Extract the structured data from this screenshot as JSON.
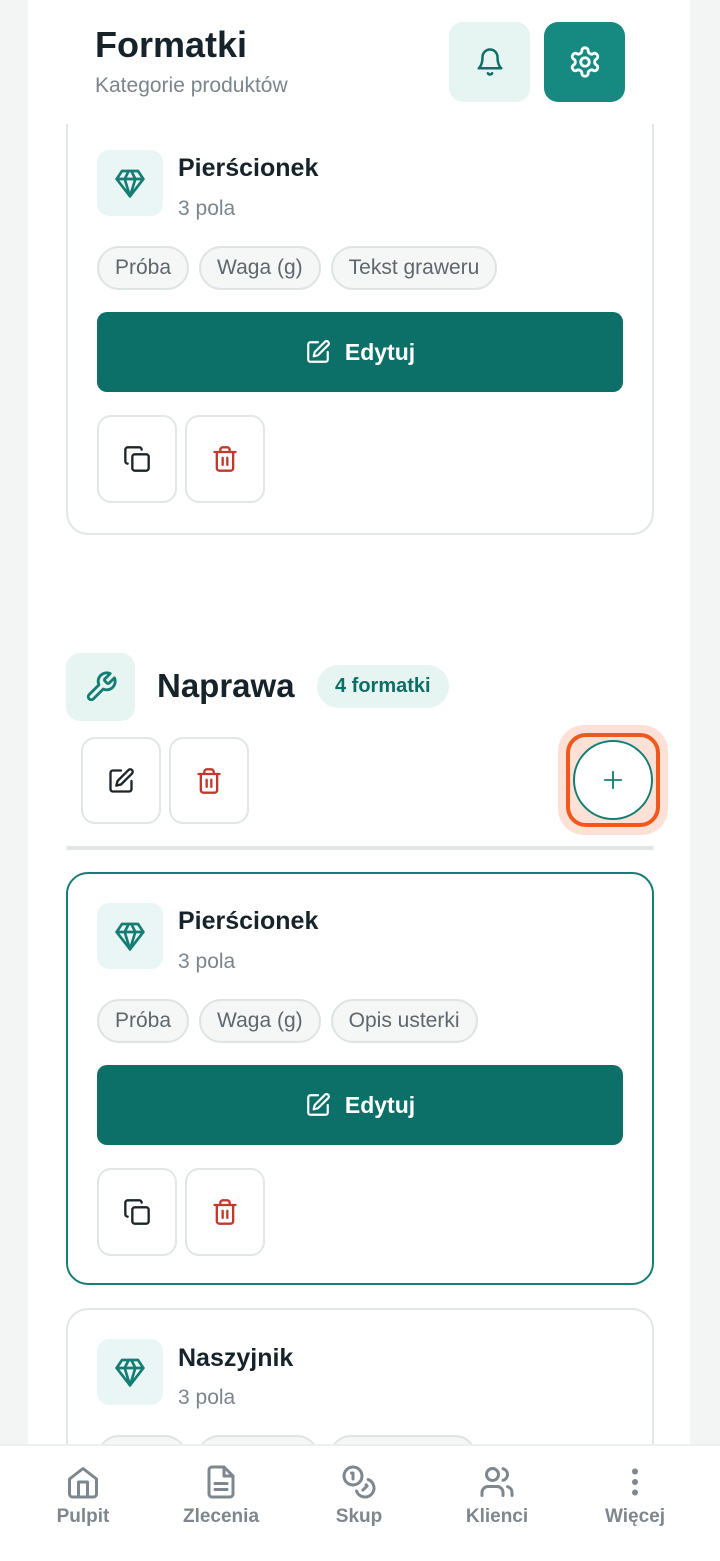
{
  "header": {
    "title": "Formatki",
    "subtitle": "Kategorie produktów",
    "icons": {
      "notifications": "bell-icon",
      "settings": "gear-icon"
    }
  },
  "cards": [
    {
      "title": "Pierścionek",
      "subtitle": "3 pola",
      "chips": [
        "Próba",
        "Waga (g)",
        "Tekst graweru"
      ],
      "edit_label": "Edytuj"
    },
    {
      "title": "Pierścionek",
      "subtitle": "3 pola",
      "chips": [
        "Próba",
        "Waga (g)",
        "Opis usterki"
      ],
      "edit_label": "Edytuj"
    },
    {
      "title": "Naszyjnik",
      "subtitle": "3 pola"
    }
  ],
  "section": {
    "title": "Naprawa",
    "badge": "4 formatki"
  },
  "nav": [
    {
      "label": "Pulpit",
      "icon": "home-icon"
    },
    {
      "label": "Zlecenia",
      "icon": "document-icon"
    },
    {
      "label": "Skup",
      "icon": "coins-icon"
    },
    {
      "label": "Klienci",
      "icon": "users-icon"
    },
    {
      "label": "Więcej",
      "icon": "more-vertical-icon"
    }
  ],
  "colors": {
    "primary": "#0d7068",
    "accent": "#168a80",
    "danger": "#c0392b",
    "highlight": "#f0581e"
  }
}
